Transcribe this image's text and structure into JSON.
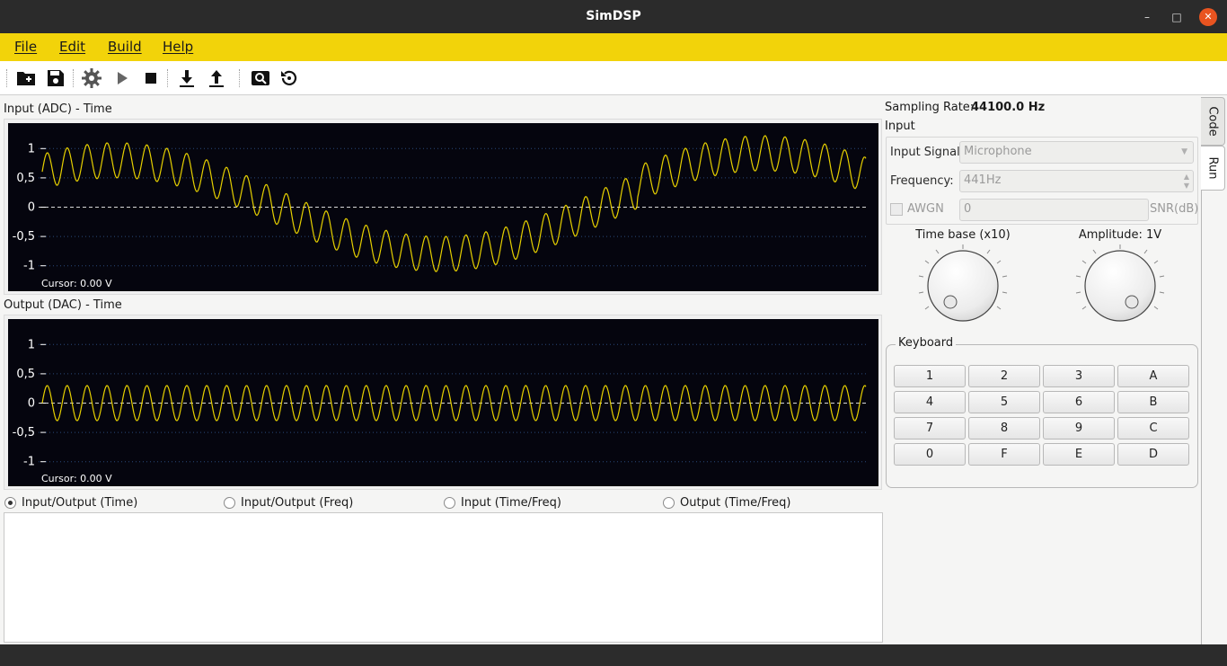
{
  "window": {
    "title": "SimDSP"
  },
  "menu": {
    "items": [
      "File",
      "Edit",
      "Build",
      "Help"
    ]
  },
  "toolbar": {
    "buttons": [
      "new-folder-icon",
      "save-icon",
      "settings-icon",
      "play-icon",
      "stop-icon",
      "download-icon",
      "upload-icon",
      "zoom-icon",
      "reset-icon"
    ]
  },
  "scopes": {
    "input": {
      "label": "Input (ADC) - Time",
      "cursor": "Cursor: 0.00 V"
    },
    "output": {
      "label": "Output (DAC) - Time",
      "cursor": "Cursor: 0.00 V"
    },
    "y_ticks": [
      "1",
      "0,5",
      "0",
      "-0,5",
      "-1"
    ],
    "trace_color": "#e6d000"
  },
  "view_modes": {
    "options": [
      "Input/Output (Time)",
      "Input/Output (Freq)",
      "Input (Time/Freq)",
      "Output (Time/Freq)"
    ],
    "selected": "Input/Output (Time)"
  },
  "right_panel": {
    "sampling_rate_label": "Sampling Rate:",
    "sampling_rate_value": "44100.0 Hz",
    "input_title": "Input",
    "input_signal_label": "Input Signal:",
    "input_signal_value": "Microphone",
    "frequency_label": "Frequency:",
    "frequency_value": "441Hz",
    "awgn_label": "AWGN",
    "snr_value": "0",
    "snr_label": "SNR(dB)",
    "time_base_label": "Time base (x10)",
    "amplitude_label": "Amplitude: 1V",
    "keyboard_title": "Keyboard",
    "keys": [
      "1",
      "2",
      "3",
      "A",
      "4",
      "5",
      "6",
      "B",
      "7",
      "8",
      "9",
      "C",
      "0",
      "F",
      "E",
      "D"
    ]
  },
  "tabs": {
    "code": "Code",
    "run": "Run",
    "active": "Run"
  }
}
